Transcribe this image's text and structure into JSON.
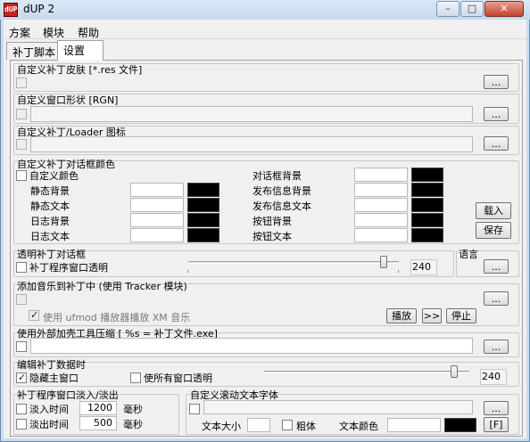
{
  "window": {
    "title": "dUP 2",
    "icon_text": "dUP",
    "min": "–",
    "max": "□",
    "close": "✕"
  },
  "menu": [
    "方案",
    "模块",
    "帮助"
  ],
  "tabs": [
    "补丁脚本",
    "设置"
  ],
  "skin": {
    "label": "自定义补丁皮肤 [*.res 文件]",
    "browse": "..."
  },
  "shape": {
    "label": "自定义窗口形状 [RGN]",
    "browse": "..."
  },
  "loader_icon": {
    "label": "自定义补丁/Loader 图标",
    "browse": "..."
  },
  "dialog_colors": {
    "group_label": "自定义补丁对话框颜色",
    "custom_color": "自定义颜色",
    "left": [
      "静态背景",
      "静态文本",
      "日志背景",
      "日志文本"
    ],
    "right": [
      "对话框背景",
      "发布信息背景",
      "发布信息文本",
      "按钮背景",
      "按钮文本"
    ],
    "load": "载入",
    "save": "保存"
  },
  "transparent": {
    "group_label": "透明补丁对话框",
    "window_transparent": "补丁程序窗口透明",
    "value": "240",
    "level": 240,
    "max": 255
  },
  "language": {
    "label": "语言",
    "browse": "..."
  },
  "music": {
    "label": "添加音乐到补丁中 (使用 Tracker 模块)",
    "browse": "...",
    "ufmod": "使用 ufmod 播放器播放 XM 音乐",
    "play": "播放",
    "next": ">>",
    "stop": "停止"
  },
  "packer": {
    "label": "使用外部加壳工具压缩 [ %s = 补丁文件.exe]",
    "browse": "..."
  },
  "edit": {
    "group_label": "编辑补丁数据时",
    "hide_main": "隐藏主窗口",
    "all_transparent": "使所有窗口透明",
    "value": "240",
    "level": 240,
    "max": 255
  },
  "fade": {
    "group_label": "补丁程序窗口淡入/淡出",
    "fade_in": "淡入时间",
    "fade_in_value": "1200",
    "fade_out": "淡出时间",
    "fade_out_value": "500",
    "unit": "毫秒"
  },
  "scroll_font": {
    "group_label": "自定义滚动文本字体",
    "browse": "...",
    "size_label": "文本大小",
    "bold": "粗体",
    "color_label": "文本颜色",
    "font_btn": "[F]"
  }
}
